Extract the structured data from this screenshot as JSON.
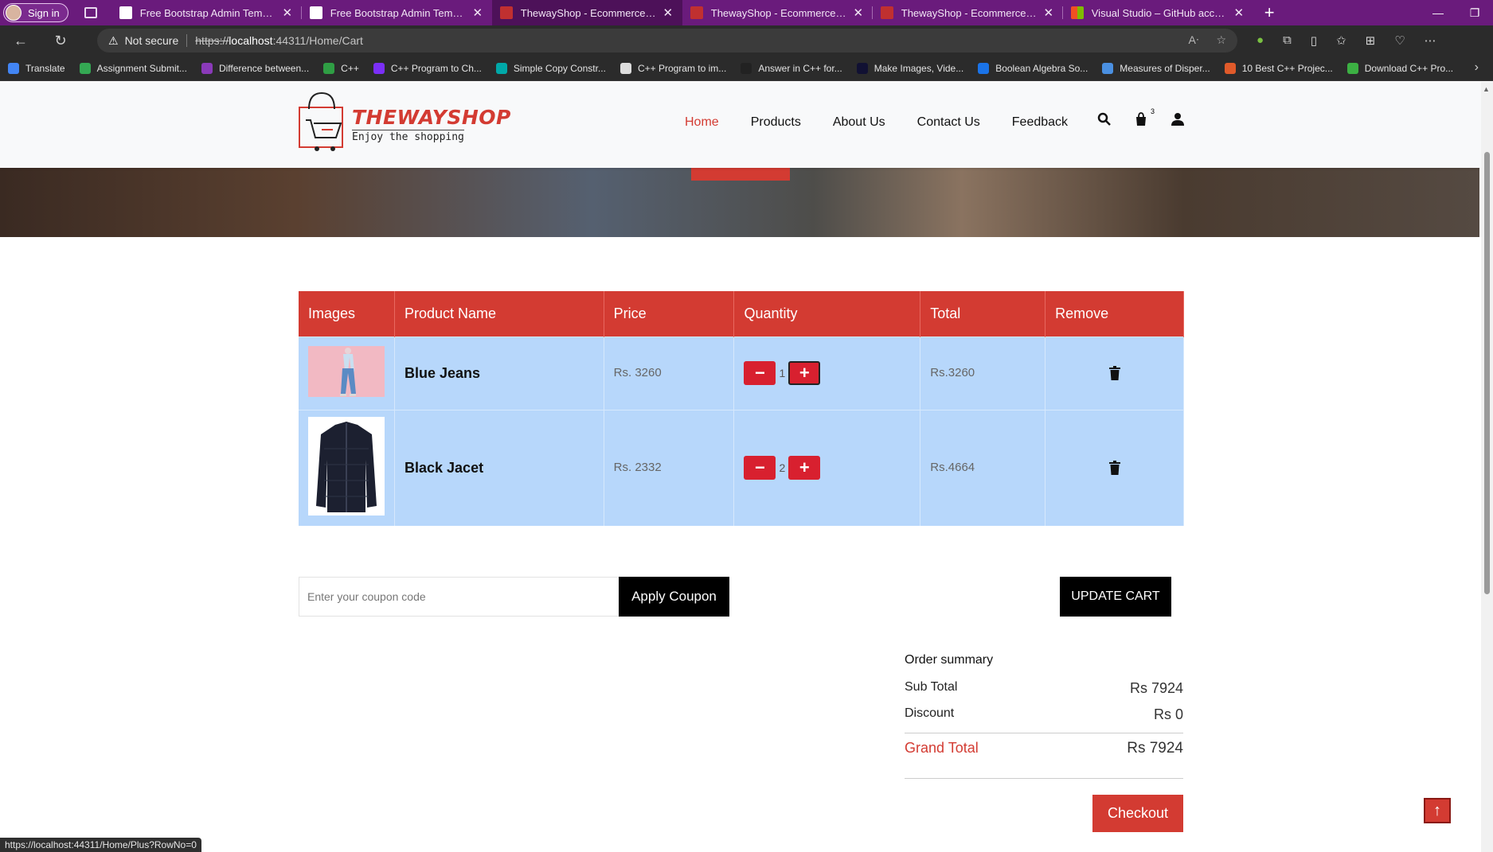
{
  "browser": {
    "signin_label": "Sign in",
    "tabs": [
      {
        "title": "Free Bootstrap Admin Template",
        "color": "#ffffff"
      },
      {
        "title": "Free Bootstrap Admin Template",
        "color": "#ffffff"
      },
      {
        "title": "ThewayShop - Ecommerce Bootstrap",
        "color": "#c03030"
      },
      {
        "title": "ThewayShop - Ecommerce Bootstrap",
        "color": "#c03030"
      },
      {
        "title": "ThewayShop - Ecommerce Bootstrap",
        "color": "#c03030"
      },
      {
        "title": "Visual Studio – GitHub account s",
        "color": "#f25022"
      }
    ],
    "address": {
      "security": "Not secure",
      "scheme": "https://",
      "host": "localhost",
      "path": ":44311/Home/Cart"
    },
    "bookmarks": [
      {
        "label": "Translate",
        "color": "#4285f4"
      },
      {
        "label": "Assignment Submit...",
        "color": "#34a853"
      },
      {
        "label": "Difference between...",
        "color": "#8a3ab9"
      },
      {
        "label": "C++",
        "color": "#2f9e44"
      },
      {
        "label": "C++ Program to Ch...",
        "color": "#7b2ff7"
      },
      {
        "label": "Simple Copy Constr...",
        "color": "#00a8a8"
      },
      {
        "label": "C++ Program to im...",
        "color": "#dddddd"
      },
      {
        "label": "Answer in C++ for...",
        "color": "#222222"
      },
      {
        "label": "Make Images, Vide...",
        "color": "#111133"
      },
      {
        "label": "Boolean Algebra So...",
        "color": "#1a73e8"
      },
      {
        "label": "Measures of Disper...",
        "color": "#4a90e2"
      },
      {
        "label": "10 Best C++ Projec...",
        "color": "#e05a2a"
      },
      {
        "label": "Download C++ Pro...",
        "color": "#3cb043"
      }
    ],
    "status_url": "https://localhost:44311/Home/Plus?RowNo=0"
  },
  "site": {
    "logo_title": "THEWAYSHOP",
    "logo_tagline": "Enjoy the shopping",
    "nav": [
      "Home",
      "Products",
      "About Us",
      "Contact Us",
      "Feedback"
    ],
    "active_nav": "Home",
    "cart_count": "3",
    "accent_color": "#d33b32"
  },
  "cart": {
    "headers": [
      "Images",
      "Product Name",
      "Price",
      "Quantity",
      "Total",
      "Remove"
    ],
    "rows": [
      {
        "image": "jeans",
        "name": "Blue Jeans",
        "price": "Rs. 3260",
        "qty": "1",
        "total": "Rs.3260"
      },
      {
        "image": "jacket",
        "name": "Black Jacet",
        "price": "Rs. 2332",
        "qty": "2",
        "total": "Rs.4664"
      }
    ],
    "coupon_placeholder": "Enter your coupon code",
    "apply_label": "Apply Coupon",
    "update_label": "UPDATE CART"
  },
  "summary": {
    "title": "Order summary",
    "subtotal_label": "Sub Total",
    "subtotal_value": "Rs 7924",
    "discount_label": "Discount",
    "discount_value": "Rs 0",
    "grand_label": "Grand Total",
    "grand_value": "Rs 7924",
    "checkout_label": "Checkout"
  }
}
